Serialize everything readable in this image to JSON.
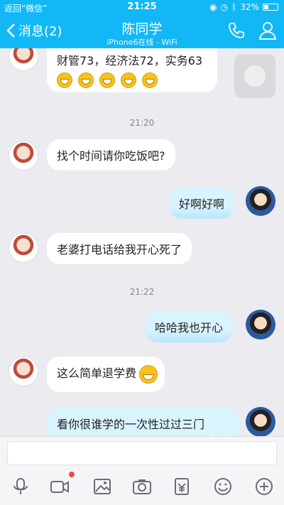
{
  "status": {
    "left": "返回“微信”",
    "time": "21:25",
    "battery": "32%",
    "battery_level": 0.32
  },
  "header": {
    "back_label": "消息(2)",
    "title": "陈同学",
    "subtitle": "iPhone6在线 - WiFi"
  },
  "messages": {
    "m1": "财管73，经济法72，实务63",
    "t1": "21:20",
    "m2": "找个时间请你吃饭吧?",
    "m3": "好啊好啊",
    "m4": "老婆打电话给我开心死了",
    "t2": "21:22",
    "m5": "哈哈我也开心",
    "m6": "这么简单退学费",
    "m7": "看你很谁学的一次性过过三门"
  },
  "watermark": "Laoke 老客",
  "colors": {
    "header": "#12b7f5",
    "bubble_right": "#ccf0ff"
  }
}
